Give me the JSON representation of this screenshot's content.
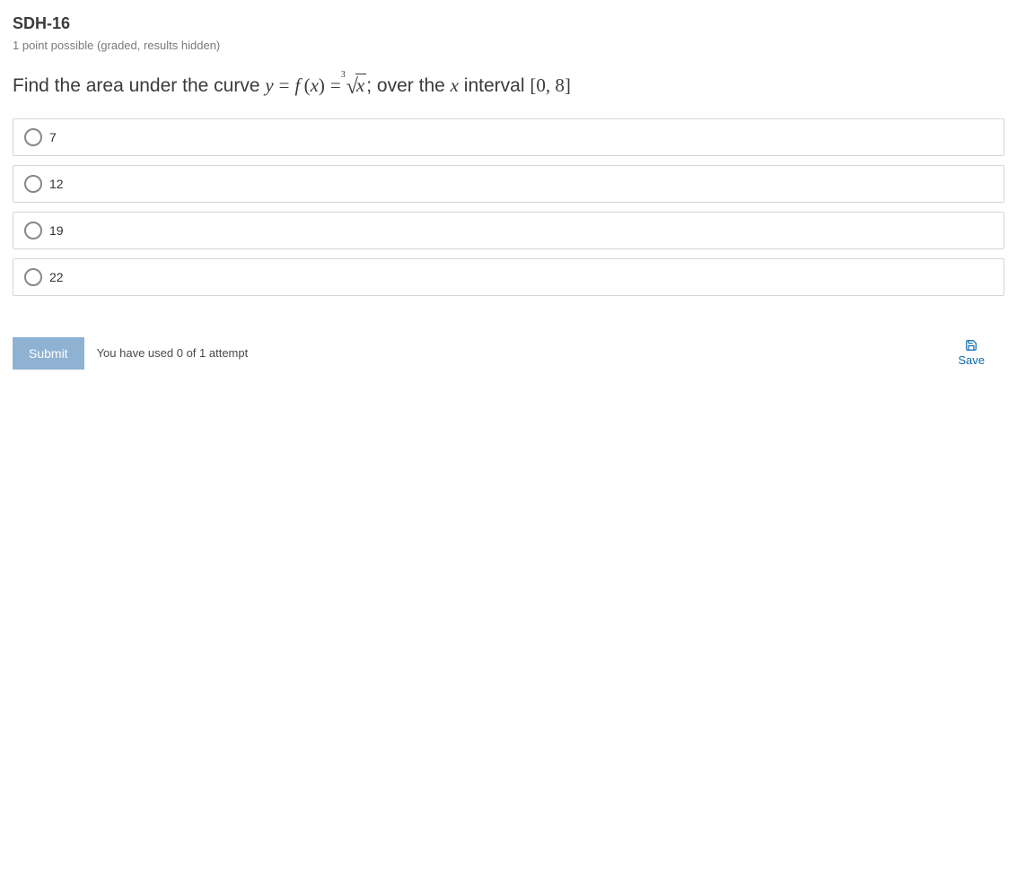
{
  "header": {
    "title": "SDH-16",
    "subtitle": "1 point possible (graded, results hidden)"
  },
  "question": {
    "lead": "Find the area under the curve ",
    "y": "y",
    "eq": "=",
    "f": "f",
    "lparen": "(",
    "x1": "x",
    "rparen": ")",
    "root_index": "3",
    "radicand": "x",
    "after_root": "; over the ",
    "x2": "x",
    "interval_lead": " interval ",
    "interval": "[0, 8]"
  },
  "options": [
    {
      "label": "7"
    },
    {
      "label": "12"
    },
    {
      "label": "19"
    },
    {
      "label": "22"
    }
  ],
  "footer": {
    "submit": "Submit",
    "attempts": "You have used 0 of 1 attempt",
    "save": "Save"
  }
}
